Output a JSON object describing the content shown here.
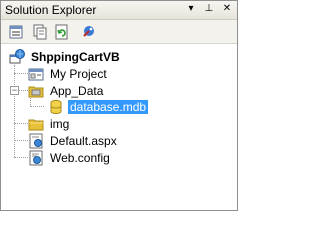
{
  "window": {
    "title": "Solution Explorer",
    "buttons": {
      "dropdown": "▾",
      "pin": "⊥",
      "close": "✕"
    }
  },
  "toolbar": {
    "items": [
      {
        "name": "properties-icon"
      },
      {
        "name": "show-all-files-icon"
      },
      {
        "name": "refresh-icon"
      },
      {
        "name": "copy-website-icon"
      }
    ]
  },
  "tree": {
    "project": "ShppingCartVB",
    "items": [
      {
        "label": "My Project"
      },
      {
        "label": "App_Data"
      },
      {
        "label": "database.mdb"
      },
      {
        "label": "img"
      },
      {
        "label": "Default.aspx"
      },
      {
        "label": "Web.config"
      }
    ]
  },
  "colors": {
    "selection": "#3399ff",
    "folder": "#e8c13a",
    "window_border": "#8f8f8f"
  }
}
